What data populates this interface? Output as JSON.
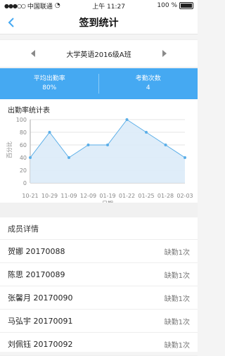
{
  "status_bar": {
    "carrier": "中国联通",
    "time": "上午 11:27",
    "battery": "100 %"
  },
  "nav": {
    "title": "签到统计",
    "back_icon": "chevron-left-icon"
  },
  "class_switch": {
    "class_name": "大学英语2016级A班",
    "prev_icon": "triangle-left-icon",
    "next_icon": "triangle-right-icon"
  },
  "stats": [
    {
      "label": "平均出勤率",
      "value": "80%"
    },
    {
      "label": "考勤次数",
      "value": "4"
    }
  ],
  "chart": {
    "title": "出勤率统计表",
    "accent_color": "#5aaee8",
    "fill_color": "#dcebf8"
  },
  "chart_data": {
    "type": "area",
    "title": "出勤率统计表",
    "xlabel": "日期",
    "ylabel": "百分比",
    "categories": [
      "10-21",
      "10-29",
      "11-09",
      "12-09",
      "01-19",
      "01-22",
      "01-25",
      "01-28",
      "02-03"
    ],
    "values": [
      40,
      80,
      40,
      60,
      60,
      100,
      80,
      60,
      40
    ],
    "ylim": [
      0,
      100
    ],
    "yticks": [
      0,
      20,
      40,
      60,
      80,
      100
    ],
    "grid": true
  },
  "members": {
    "title": "成员详情",
    "rows": [
      {
        "name": "贺娜 20170088",
        "status": "缺勤1次"
      },
      {
        "name": "陈思 20170089",
        "status": "缺勤1次"
      },
      {
        "name": "张馨月 20170090",
        "status": "缺勤1次"
      },
      {
        "name": "马弘宇 20170091",
        "status": "缺勤1次"
      },
      {
        "name": "刘佩钰 20170092",
        "status": "缺勤1次"
      }
    ]
  }
}
